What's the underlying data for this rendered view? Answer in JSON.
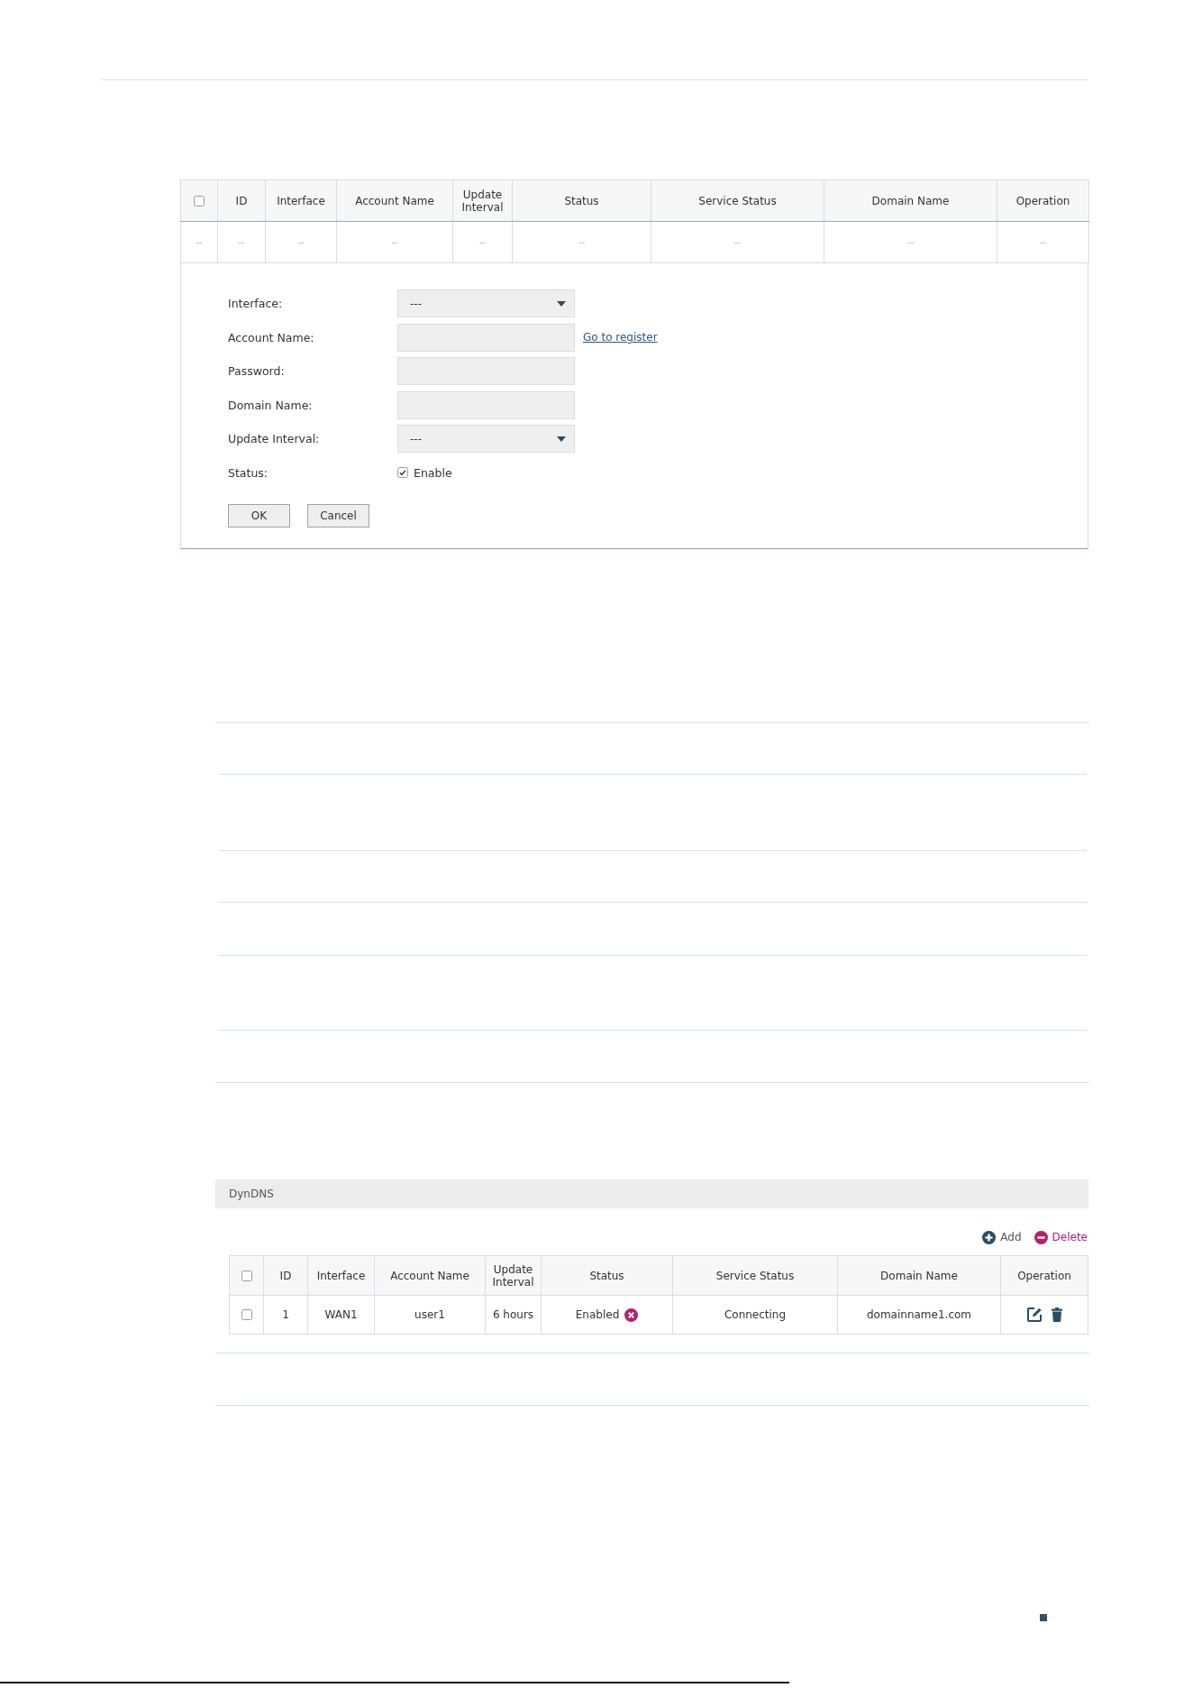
{
  "config_table": {
    "columns": [
      {
        "kind": "checkbox",
        "checked": false
      },
      {
        "kind": "text",
        "label": "ID"
      },
      {
        "kind": "text",
        "label": "Interface"
      },
      {
        "kind": "text",
        "label": "Account Name"
      },
      {
        "kind": "text",
        "label": "Update Interval"
      },
      {
        "kind": "text",
        "label": "Status"
      },
      {
        "kind": "text",
        "label": "Service Status"
      },
      {
        "kind": "text",
        "label": "Domain Name"
      },
      {
        "kind": "text",
        "label": "Operation"
      }
    ],
    "rows": [
      {
        "cells": [
          "--",
          "--",
          "--",
          "--",
          "--",
          "--",
          "--",
          "--",
          "--"
        ]
      }
    ]
  },
  "form": {
    "fields": [
      {
        "kind": "select",
        "label": "Interface:",
        "value": "---"
      },
      {
        "kind": "text",
        "label": "Account Name:",
        "link": "Go to register"
      },
      {
        "kind": "password",
        "label": "Password:"
      },
      {
        "kind": "text",
        "label": "Domain Name:"
      },
      {
        "kind": "select",
        "label": "Update Interval:",
        "value": "---"
      },
      {
        "kind": "checkbox",
        "label": "Status:",
        "option": "Enable",
        "checked": true
      }
    ],
    "buttons": [
      "OK",
      "Cancel"
    ]
  },
  "dyndns": {
    "title": "DynDNS",
    "actions": [
      {
        "kind": "add",
        "label": "Add"
      },
      {
        "kind": "delete",
        "label": "Delete"
      }
    ],
    "table": {
      "columns": [
        {
          "kind": "checkbox",
          "checked": false
        },
        {
          "kind": "text",
          "label": "ID"
        },
        {
          "kind": "text",
          "label": "Interface"
        },
        {
          "kind": "text",
          "label": "Account Name"
        },
        {
          "kind": "text",
          "label": "Update Interval"
        },
        {
          "kind": "text",
          "label": "Status"
        },
        {
          "kind": "text",
          "label": "Service Status"
        },
        {
          "kind": "text",
          "label": "Domain Name"
        },
        {
          "kind": "text",
          "label": "Operation"
        }
      ],
      "rows": [
        {
          "cells": [
            {
              "kind": "checkbox",
              "checked": false
            },
            {
              "kind": "text",
              "text": "1"
            },
            {
              "kind": "text",
              "text": "WAN1"
            },
            {
              "kind": "text",
              "text": "user1"
            },
            {
              "kind": "text",
              "text": "6 hours"
            },
            {
              "kind": "status",
              "text": "Enabled"
            },
            {
              "kind": "text",
              "text": "Connecting"
            },
            {
              "kind": "text",
              "text": "domainname1.com"
            },
            {
              "kind": "actions"
            }
          ]
        }
      ]
    }
  }
}
